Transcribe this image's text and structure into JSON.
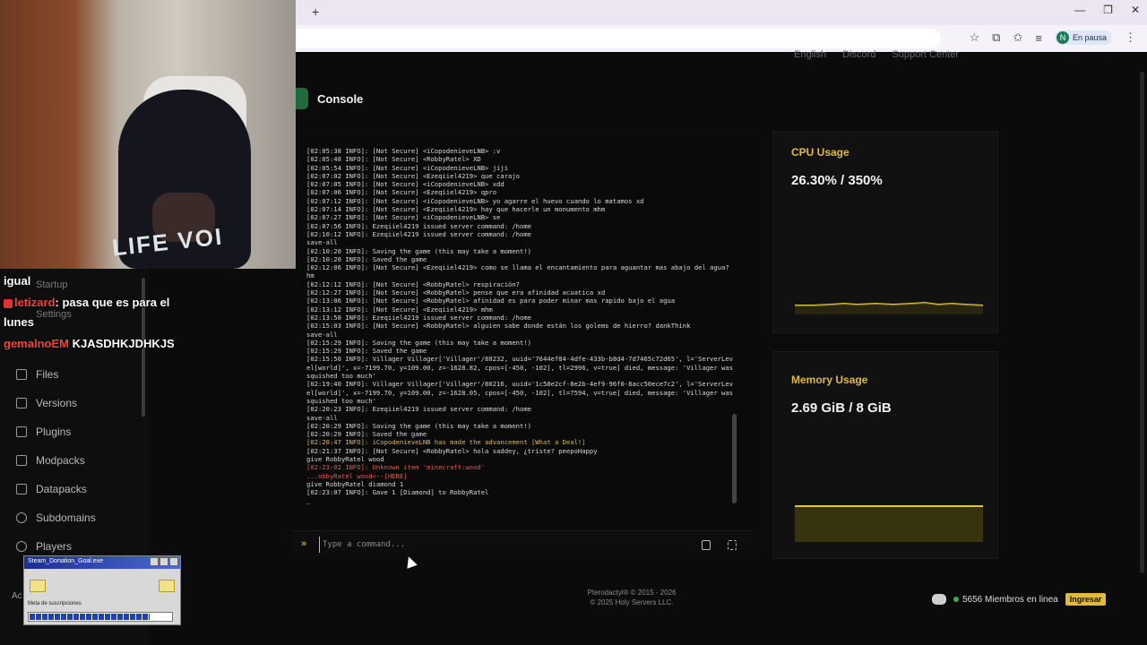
{
  "browser": {
    "new_tab": "+",
    "profile_initial": "N",
    "profile_status": "En pausa",
    "window_controls": [
      "—",
      "❐",
      "✕"
    ]
  },
  "top_links": [
    "English",
    "Discord",
    "Support Center"
  ],
  "webcam": {
    "shirt_print": "LIFE VOI"
  },
  "chat": {
    "lines": [
      {
        "user": "",
        "text": "igual"
      },
      {
        "user": "letizard",
        "text": ": pasa que es para el"
      },
      {
        "user": "",
        "text": "lunes"
      },
      {
        "user": "gemalnoEM",
        "text": " KJASDHKJDHKJS"
      }
    ]
  },
  "sidebar": {
    "dim_items": [
      "Startup",
      "Settings"
    ],
    "items": [
      {
        "label": "Files",
        "icon": "file-icon"
      },
      {
        "label": "Versions",
        "icon": "layers-icon"
      },
      {
        "label": "Plugins",
        "icon": "plug-icon"
      },
      {
        "label": "Modpacks",
        "icon": "package-icon"
      },
      {
        "label": "Datapacks",
        "icon": "database-icon"
      },
      {
        "label": "Subdomains",
        "icon": "globe-icon"
      },
      {
        "label": "Players",
        "icon": "users-icon"
      }
    ],
    "truncated_label": "Ac"
  },
  "goal_widget": {
    "title": "Steam_Donation_Goal.exe",
    "label": "Meta de suscripciones",
    "progress": 0.85
  },
  "console": {
    "title": "Console",
    "log": [
      "[02:05:38 INFO]: [Not Secure] <iCopodenieveLNB> :v",
      "[02:05:48 INFO]: [Not Secure] <RobbyRatel> XD",
      "[02:05:54 INFO]: [Not Secure] <iCopodenieveLNB> jiji",
      "[02:07:02 INFO]: [Not Secure] <Ezeqiiel4219> que carajo",
      "[02:07:05 INFO]: [Not Secure] <iCopodenieveLNB> xdd",
      "[02:07:06 INFO]: [Not Secure] <Ezeqiiel4219> qpro",
      "[02:07:12 INFO]: [Not Secure] <iCopodenieveLNB> yo agarre el huevo cuando lo matamos xd",
      "[02:07:14 INFO]: [Not Secure] <Ezeqiiel4219> hay que hacerle un monumento mhm",
      "[02:07:27 INFO]: [Not Secure] <iCopodenieveLNB> se",
      "[02:07:56 INFO]: Ezeqiiel4219 issued server command: /home",
      "[02:10:12 INFO]: Ezeqiiel4219 issued server command: /home",
      "save-all",
      "[02:10:20 INFO]: Saving the game (this may take a moment!)",
      "[02:10:20 INFO]: Saved the game",
      "[02:12:06 INFO]: [Not Secure] <Ezeqiiel4219> como se llama el encantamiento para aguantar mas abajo del agua? hm",
      "[02:12:12 INFO]: [Not Secure] <RobbyRatel> respiración?",
      "[02:12:27 INFO]: [Not Secure] <RobbyRatel> pense que era afinidad acuatica xd",
      "[02:13:06 INFO]: [Not Secure] <RobbyRatel> afinidad es para poder minar mas rapido bajo el agua",
      "[02:13:12 INFO]: [Not Secure] <Ezeqiiel4219> mhm",
      "[02:13:58 INFO]: Ezeqiiel4219 issued server command: /home",
      "[02:15:03 INFO]: [Not Secure] <RobbyRatel> alguien sabe donde están los golems de hierro? dankThink",
      "save-all",
      "[02:15:29 INFO]: Saving the game (this may take a moment!)",
      "[02:15:29 INFO]: Saved the game",
      "[02:15:50 INFO]: Villager Villager['Villager'/80232, uuid='7644ef84-4dfe-433b-b8d4-7d7465c72d65', l='ServerLevel[world]', x=-7199.70, y=109.00, z=-1628.82, cpos=[-450, -102], tl=2996, v=true] died, message: 'Villager was squished too much'",
      "[02:19:40 INFO]: Villager Villager['Villager'/80216, uuid='1c58e2cf-8e2b-4ef9-96f0-8acc50ece7c2', l='ServerLevel[world]', x=-7199.70, y=109.00, z=-1628.05, cpos=[-450, -102], tl=7594, v=true] died, message: 'Villager was squished too much'",
      "[02:20:23 INFO]: Ezeqiiel4219 issued server command: /home",
      "save-all",
      "[02:20:29 INFO]: Saving the game (this may take a moment!)",
      "[02:20:29 INFO]: Saved the game",
      "[02:20:47 INFO]: iCopodenieveLNB has made the advancement [What a Deal!]",
      "[02:21:37 INFO]: [Not Secure] <RobbyRatel> hola saddey, ¿triste? peepoHappy",
      "give RobbyRatel wood",
      "[02:23:02 INFO]: Unknown item 'minecraft:wood'",
      "...obbyRatel wood<--[HERE]",
      "give RobbyRatel diamond 1",
      "[02:23:07 INFO]: Gave 1 [Diamond] to RobbyRatel",
      "_"
    ],
    "command_prompt": "»",
    "command_placeholder": "Type a command..."
  },
  "cpu": {
    "title": "CPU Usage",
    "value": "26.30% / 350%"
  },
  "memory": {
    "title": "Memory Usage",
    "value": "2.69 GiB / 8 GiB"
  },
  "footer": {
    "line1": "Pterodactyl® © 2015 - 2026",
    "line2": "© 2025 Holy Servers LLC."
  },
  "discord_widget": {
    "members": "5656 Miembros en linea",
    "join": "Ingresar"
  },
  "colors": {
    "accent": "#e2b93b",
    "error": "#e85555",
    "background": "#0b0b0b",
    "chart_line": "#e2c53a"
  }
}
